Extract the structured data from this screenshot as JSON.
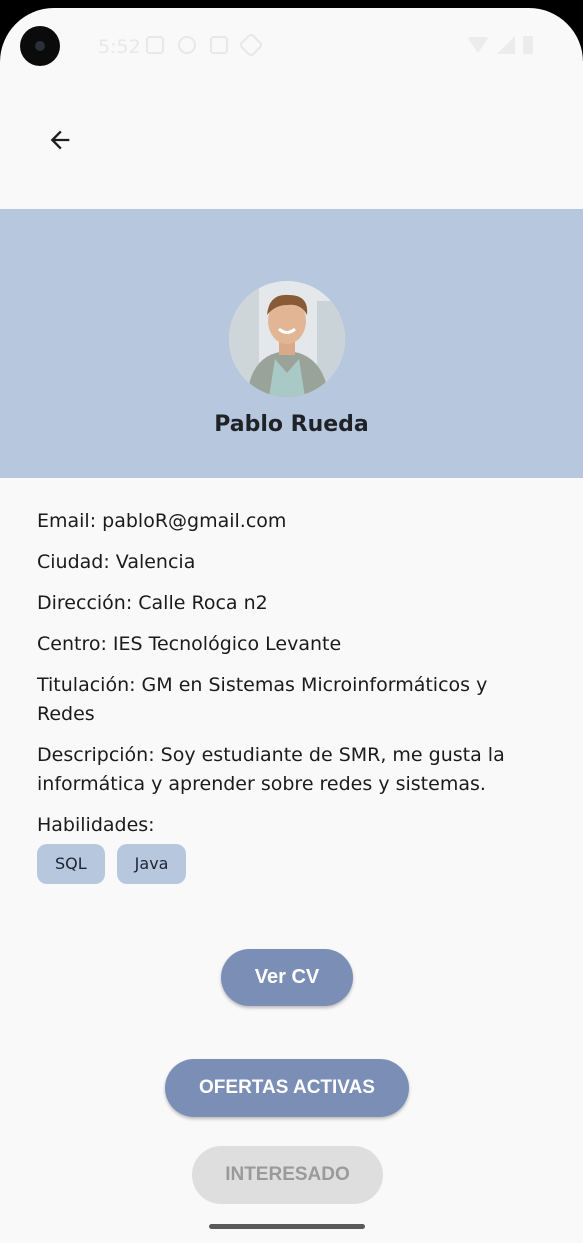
{
  "status_bar": {
    "time": "5:52"
  },
  "profile": {
    "name": "Pablo Rueda"
  },
  "details": {
    "email": "Email: pabloR@gmail.com",
    "city": "Ciudad: Valencia",
    "address": "Dirección: Calle Roca n2",
    "center": "Centro: IES Tecnológico Levante",
    "degree": "Titulación: GM en Sistemas Microinformáticos y Redes",
    "description": "Descripción: Soy estudiante de SMR, me gusta la informática y aprender sobre redes y sistemas.",
    "skills_label": "Habilidades:",
    "skills": [
      "SQL",
      "Java"
    ]
  },
  "buttons": {
    "view_cv": "Ver CV",
    "active_offers": "OFERTAS ACTIVAS",
    "interested": "INTERESADO"
  },
  "colors": {
    "header_bg": "#b6c7de",
    "primary_button": "#7b8fb6",
    "disabled_button": "#dedede",
    "chip_bg": "#b6c7de"
  }
}
